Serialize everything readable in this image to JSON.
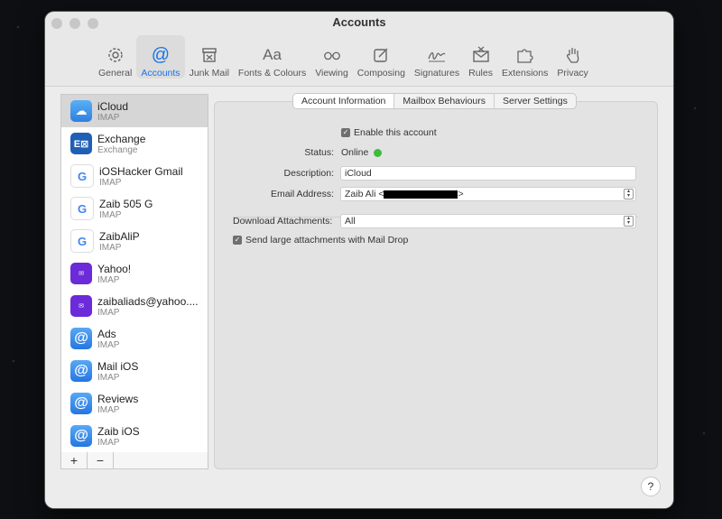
{
  "window": {
    "title": "Accounts"
  },
  "toolbar": {
    "items": [
      {
        "label": "General",
        "icon": "gear-icon"
      },
      {
        "label": "Accounts",
        "icon": "at-icon",
        "active": true
      },
      {
        "label": "Junk Mail",
        "icon": "junk-icon"
      },
      {
        "label": "Fonts & Colours",
        "icon": "font-icon"
      },
      {
        "label": "Viewing",
        "icon": "glasses-icon"
      },
      {
        "label": "Composing",
        "icon": "compose-icon"
      },
      {
        "label": "Signatures",
        "icon": "signature-icon"
      },
      {
        "label": "Rules",
        "icon": "rules-icon"
      },
      {
        "label": "Extensions",
        "icon": "puzzle-icon"
      },
      {
        "label": "Privacy",
        "icon": "hand-icon"
      }
    ]
  },
  "accounts": [
    {
      "name": "iCloud",
      "type": "IMAP",
      "icon": "icloud-icon"
    },
    {
      "name": "Exchange",
      "type": "Exchange",
      "icon": "exchange-icon"
    },
    {
      "name": "iOSHacker Gmail",
      "type": "IMAP",
      "icon": "google-icon"
    },
    {
      "name": "Zaib 505 G",
      "type": "IMAP",
      "icon": "google-icon"
    },
    {
      "name": "ZaibAliP",
      "type": "IMAP",
      "icon": "google-icon"
    },
    {
      "name": "Yahoo!",
      "type": "IMAP",
      "icon": "yahoo-icon"
    },
    {
      "name": "zaibaliads@yahoo....",
      "type": "IMAP",
      "icon": "yahoo-icon"
    },
    {
      "name": "Ads",
      "type": "IMAP",
      "icon": "at-icon"
    },
    {
      "name": "Mail iOS",
      "type": "IMAP",
      "icon": "at-icon"
    },
    {
      "name": "Reviews",
      "type": "IMAP",
      "icon": "at-icon"
    },
    {
      "name": "Zaib iOS",
      "type": "IMAP",
      "icon": "at-icon"
    }
  ],
  "list_buttons": {
    "add": "+",
    "remove": "−"
  },
  "tabs": [
    "Account Information",
    "Mailbox Behaviours",
    "Server Settings"
  ],
  "form": {
    "enable_label": "Enable this account",
    "status_label": "Status:",
    "status_value": "Online",
    "description_label": "Description:",
    "description_value": "iCloud",
    "email_label": "Email Address:",
    "email_prefix": "Zaib Ali <",
    "email_suffix": ">",
    "download_label": "Download Attachments:",
    "download_value": "All",
    "maildrop_label": "Send large attachments with Mail Drop"
  },
  "help": "?"
}
